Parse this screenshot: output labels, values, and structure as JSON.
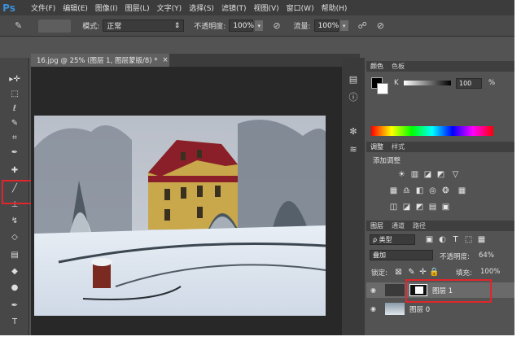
{
  "app": {
    "logo": "Ps"
  },
  "menu": [
    "文件(F)",
    "编辑(E)",
    "图像(I)",
    "图层(L)",
    "文字(Y)",
    "选择(S)",
    "滤镜(T)",
    "视图(V)",
    "窗口(W)",
    "帮助(H)"
  ],
  "options": {
    "mode_label": "模式:",
    "mode_value": "正常",
    "opacity_label": "不透明度:",
    "opacity_value": "100%",
    "flow_label": "流量:",
    "flow_value": "100%"
  },
  "document": {
    "tab_title": "16.jpg @ 25% (图层 1, 图层蒙版/8) *",
    "close": "×"
  },
  "color_panel": {
    "tabs": [
      "颜色",
      "色板"
    ],
    "channel_label": "K",
    "value": "100",
    "unit": "%"
  },
  "adjust_panel": {
    "tabs": [
      "调整",
      "样式"
    ],
    "title": "添加调整"
  },
  "layers_panel": {
    "tabs": [
      "图层",
      "通道",
      "路径"
    ],
    "filter_label": "ρ 类型",
    "blend_mode": "叠加",
    "opacity_label": "不透明度:",
    "opacity_value": "64%",
    "lock_label": "锁定:",
    "fill_label": "填充:",
    "fill_value": "100%",
    "layers": [
      {
        "name": "图层 1"
      },
      {
        "name": "图层 0"
      }
    ]
  },
  "colors": {
    "highlight": "#e0262a",
    "ps_blue": "#3a8fd8"
  }
}
